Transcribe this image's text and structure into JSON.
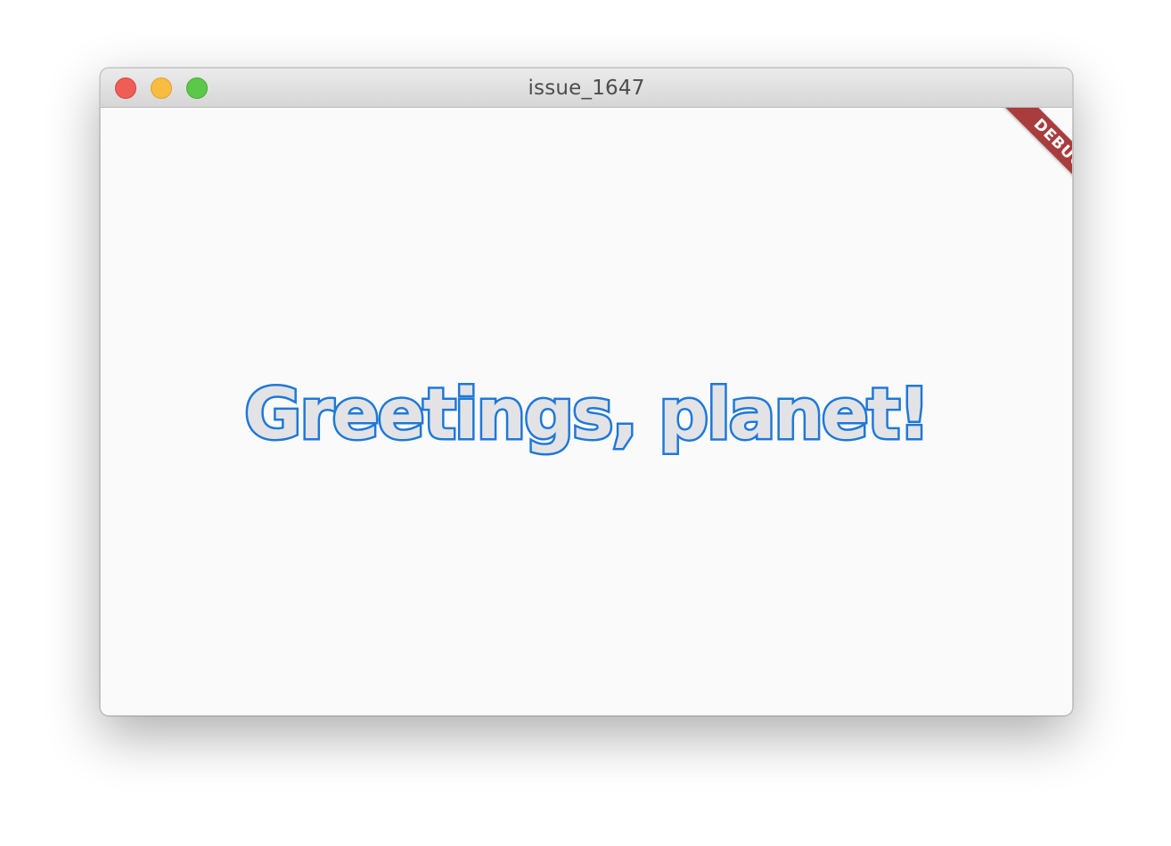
{
  "window": {
    "title": "issue_1647"
  },
  "main": {
    "greeting": "Greetings, planet!",
    "debug_banner": "DEBUG"
  },
  "colors": {
    "text_outline": "#1e78d8",
    "text_fill": "#e3e3e6",
    "debug_banner": "#a93d3d",
    "close": "#ee5e55",
    "minimize": "#f8bd40",
    "zoom": "#5cc84a"
  }
}
